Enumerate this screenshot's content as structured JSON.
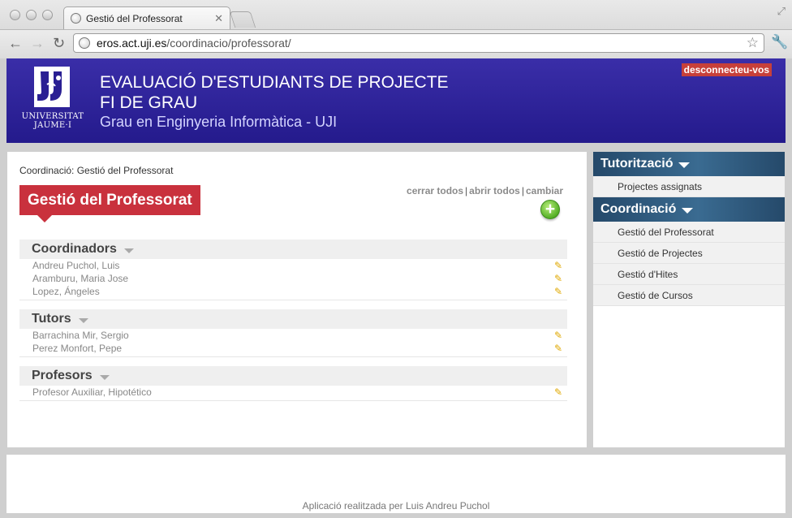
{
  "browser": {
    "tab_title": "Gestió del Professorat",
    "tab_close": "✕",
    "url_host": "eros.act.uji.es",
    "url_path": "/coordinacio/professorat/",
    "icons": {
      "back": "arrow-left-icon",
      "forward": "arrow-right-icon",
      "reload": "reload-icon",
      "bookmark": "star-icon",
      "menu": "wrench-icon",
      "fullscreen": "resize-icon"
    }
  },
  "header": {
    "logo_text_1": "UNIVERSITAT",
    "logo_text_2": "JAUME·I",
    "title_line1": "EVALUACIÓ D'ESTUDIANTS DE PROJECTE",
    "title_line2": "FI DE GRAU",
    "subtitle": "Grau en Enginyeria Informàtica - UJI",
    "logout": "desconnecteu-vos"
  },
  "main": {
    "breadcrumb": "Coordinació: Gestió del Professorat",
    "page_title": "Gestió del Professorat",
    "actions": {
      "close_all": "cerrar todos",
      "open_all": "abrir todos",
      "change": "cambiar",
      "separator": "|"
    },
    "add_symbol": "+",
    "groups": [
      {
        "title": "Coordinadors",
        "people": [
          "Andreu Puchol, Luis",
          "Aramburu, Maria Jose",
          "Lopez, Ángeles"
        ]
      },
      {
        "title": "Tutors",
        "people": [
          "Barrachina Mir, Sergio",
          "Perez Monfort, Pepe"
        ]
      },
      {
        "title": "Profesors",
        "people": [
          "Profesor Auxiliar, Hipotético"
        ]
      }
    ]
  },
  "sidebar": {
    "sections": [
      {
        "title": "Tutorització",
        "items": [
          "Projectes assignats"
        ]
      },
      {
        "title": "Coordinació",
        "items": [
          "Gestió del Professorat",
          "Gestió de Projectes",
          "Gestió d'Hites",
          "Gestió de Cursos"
        ]
      }
    ]
  },
  "footer": {
    "text": "Aplicació realitzada per Luis Andreu Puchol"
  },
  "colors": {
    "banner": "#2a1f93",
    "title_badge": "#c9313d",
    "logout_bg": "#c7403a",
    "sidebar_header": "#2e5a80",
    "edit_pencil": "#e0a800",
    "add_button": "#55b027"
  }
}
